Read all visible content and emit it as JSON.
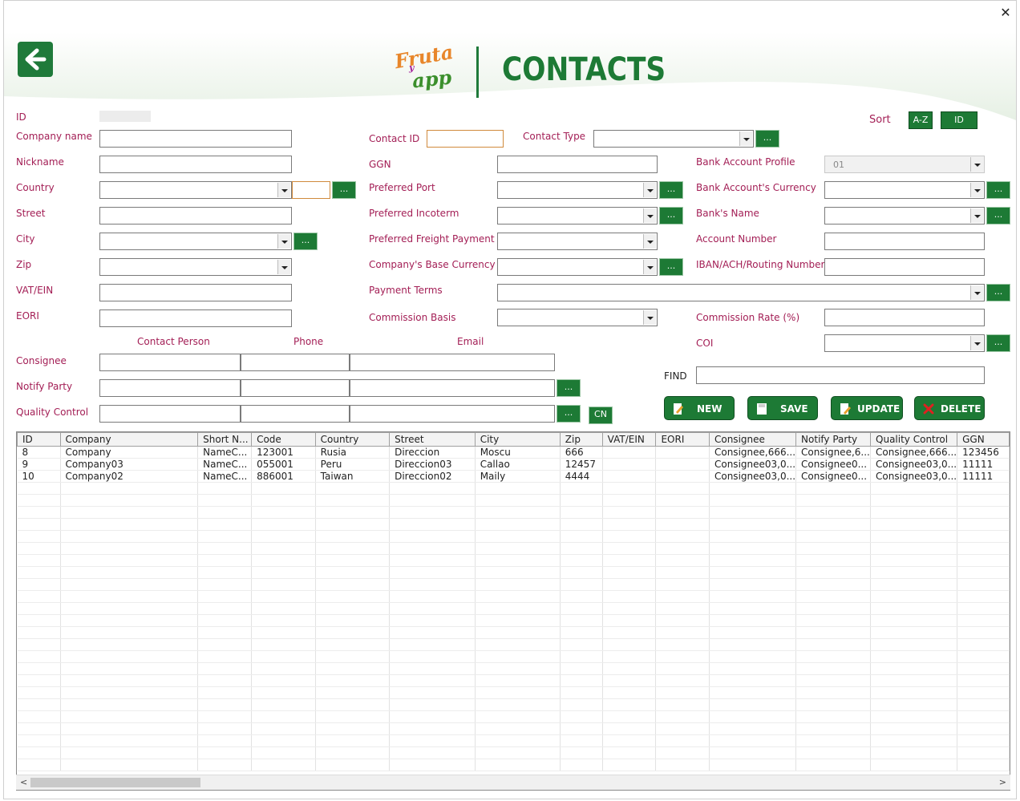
{
  "window": {
    "close_label": "✕"
  },
  "header": {
    "title": "CONTACTS",
    "logo_line1": "Fruta",
    "logo_line2": "y",
    "logo_line3": "app",
    "back_icon": "arrow-left-icon"
  },
  "colors": {
    "brand_green": "#1d7a35",
    "label_red": "#a31e55"
  },
  "sort": {
    "label": "Sort",
    "az_label": "A-Z",
    "id_label": "ID"
  },
  "form": {
    "id_label": "ID",
    "company_name_label": "Company name",
    "nickname_label": "Nickname",
    "country_label": "Country",
    "street_label": "Street",
    "city_label": "City",
    "zip_label": "Zip",
    "vat_label": "VAT/EIN",
    "eori_label": "EORI",
    "contact_id_label": "Contact ID",
    "contact_type_label": "Contact Type",
    "ggn_label": "GGN",
    "preferred_port_label": "Preferred Port",
    "preferred_incoterm_label": "Preferred Incoterm",
    "preferred_freight_label": "Preferred Freight Payment",
    "base_currency_label": "Company's Base Currency",
    "payment_terms_label": "Payment Terms",
    "commission_basis_label": "Commission Basis",
    "bank_profile_label": "Bank Account Profile",
    "bank_profile_value": "01",
    "bank_currency_label": "Bank Account's Currency",
    "bank_name_label": "Bank's Name",
    "account_number_label": "Account Number",
    "iban_label": "IBAN/ACH/Routing Number",
    "commission_rate_label": "Commission Rate (%)",
    "coi_label": "COI",
    "find_label": "FIND",
    "dots_label": "...",
    "cn_label": "CN"
  },
  "parties": {
    "contact_person_label": "Contact Person",
    "phone_label": "Phone",
    "email_label": "Email",
    "consignee_label": "Consignee",
    "notify_party_label": "Notify Party",
    "quality_control_label": "Quality Control"
  },
  "actions": {
    "new_label": "NEW",
    "save_label": "SAVE",
    "update_label": "UPDATE",
    "delete_label": "DELETE"
  },
  "table": {
    "columns": [
      "ID",
      "Company",
      "Short N...",
      "Code",
      "Country",
      "Street",
      "City",
      "Zip",
      "VAT/EIN",
      "EORI",
      "Consignee",
      "Notify Party",
      "Quality Control",
      "GGN"
    ],
    "rows": [
      [
        "8",
        "Company",
        "NameC...",
        "123001",
        "Rusia",
        "Direccion",
        "Moscu",
        "666",
        "",
        "",
        "Consignee,666...",
        "Consignee,6...",
        "Consignee,666...",
        "123456"
      ],
      [
        "9",
        "Company03",
        "NameC...",
        "055001",
        "Peru",
        "Direccion03",
        "Callao",
        "12457",
        "",
        "",
        "Consignee03,0...",
        "Consignee0...",
        "Consignee03,0...",
        "11111"
      ],
      [
        "10",
        "Company02",
        "NameC...",
        "886001",
        "Taiwan",
        "Direccion02",
        "Maily",
        "4444",
        "",
        "",
        "Consignee03,0...",
        "Consignee0...",
        "Consignee03,0...",
        "11111"
      ]
    ]
  }
}
